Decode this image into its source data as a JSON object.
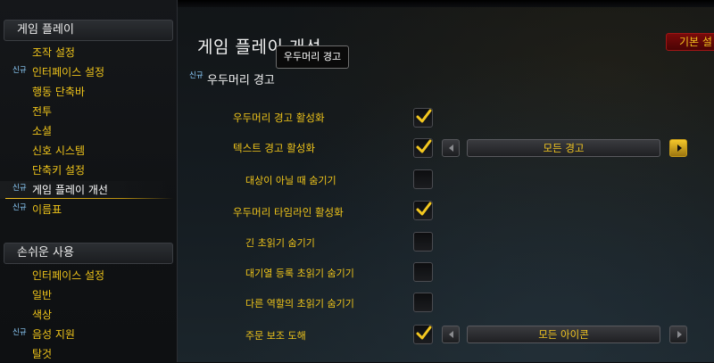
{
  "sidebar": {
    "sections": [
      {
        "header": "게임 플레이",
        "items": [
          {
            "label": "조작 설정",
            "badge": ""
          },
          {
            "label": "인터페이스 설정",
            "badge": "신규"
          },
          {
            "label": "행동 단축바",
            "badge": ""
          },
          {
            "label": "전투",
            "badge": ""
          },
          {
            "label": "소셜",
            "badge": ""
          },
          {
            "label": "신호 시스템",
            "badge": ""
          },
          {
            "label": "단축키 설정",
            "badge": ""
          },
          {
            "label": "게임 플레이 개선",
            "badge": "신규",
            "selected": true
          },
          {
            "label": "이름표",
            "badge": "신규"
          }
        ]
      },
      {
        "header": "손쉬운 사용",
        "items": [
          {
            "label": "인터페이스 설정",
            "badge": ""
          },
          {
            "label": "일반",
            "badge": ""
          },
          {
            "label": "색상",
            "badge": ""
          },
          {
            "label": "음성 지원",
            "badge": "신규"
          },
          {
            "label": "탈것",
            "badge": ""
          }
        ]
      }
    ]
  },
  "main": {
    "title": "게임 플레이 개선",
    "default_button": "기본 설",
    "tooltip": "우두머리 경고",
    "section": {
      "badge": "신규",
      "title": "우두머리 경고"
    },
    "options": [
      {
        "label": "우두머리 경고 활성화",
        "checked": true,
        "sub": false
      },
      {
        "label": "텍스트 경고 활성화",
        "checked": true,
        "sub": false,
        "dropdown": "모든 경고"
      },
      {
        "label": "대상이 아닐 때 숨기기",
        "checked": false,
        "sub": true
      },
      {
        "label": "우두머리 타임라인 활성화",
        "checked": true,
        "sub": false
      },
      {
        "label": "긴 초읽기 숨기기",
        "checked": false,
        "sub": true
      },
      {
        "label": "대기열 등록 초읽기 숨기기",
        "checked": false,
        "sub": true
      },
      {
        "label": "다른 역할의 초읽기 숨기기",
        "checked": false,
        "sub": true
      },
      {
        "label": "주문 보조 도해",
        "checked": true,
        "sub": true,
        "dropdown": "모든 아이콘"
      }
    ]
  },
  "colors": {
    "accent_gold": "#f0c51a",
    "badge_blue": "#8fd0ff",
    "default_button_red": "#7a0a0a"
  },
  "icons": {
    "checkmark": "checkmark-icon",
    "prev": "arrow-left-icon",
    "next": "arrow-right-icon"
  }
}
